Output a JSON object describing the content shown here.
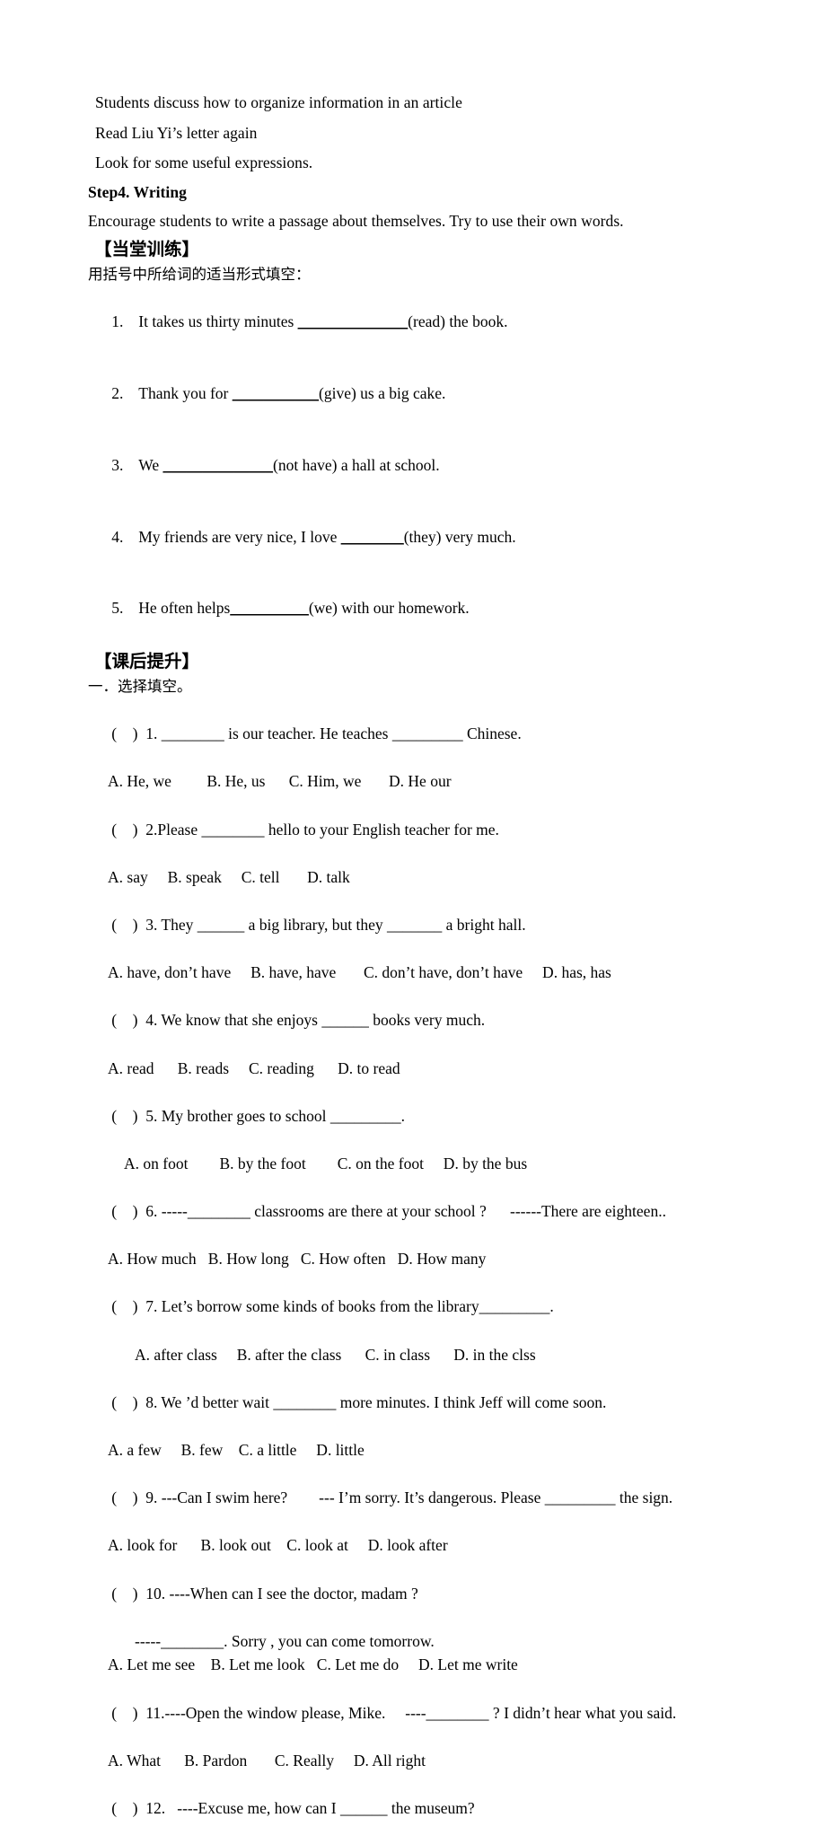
{
  "document": {
    "intro_lines": [
      "Students discuss how to organize information in an article",
      "Read Liu Yi’s letter again",
      "Look for some useful expressions."
    ],
    "step_heading": "Step4. Writing",
    "step_body": "Encourage students to write a passage about themselves. Try to use their own words.",
    "section_practice": {
      "heading": "【当堂训练】",
      "instruction": "用括号中所给词的适当形式填空：",
      "items": [
        {
          "num": "1.",
          "before": "It takes us thirty minutes ",
          "blank": "______________",
          "after": "(read) the book."
        },
        {
          "num": "2.",
          "before": "Thank you for ",
          "blank": "___________",
          "after": "(give) us a big cake."
        },
        {
          "num": "3.",
          "before": "We ",
          "blank": "______________",
          "after": "(not have) a hall at school."
        },
        {
          "num": "4.",
          "before": "My friends are very nice, I love ",
          "blank": "________",
          "after": "(they) very much."
        },
        {
          "num": "5.",
          "before": "He often helps",
          "blank": "__________",
          "after": "(we) with our homework."
        }
      ]
    },
    "section_homework": {
      "heading": "【课后提升】",
      "subheading": "一．选择填空。",
      "questions": [
        {
          "paren": "(    )",
          "stem": "1. ________ is our teacher. He teaches _________ Chinese.",
          "options": "A. He, we         B. He, us      C. Him, we       D. He our",
          "option_indent": "indent-opt"
        },
        {
          "paren": "(    )",
          "stem": "2.Please ________ hello to your English teacher for me.",
          "options": "A. say     B. speak     C. tell       D. talk",
          "option_indent": "indent-opt"
        },
        {
          "paren": "(    )",
          "stem": "3. They ______ a big library, but they _______ a bright hall.",
          "options": "A. have, don’t have     B. have, have       C. don’t have, don’t have     D. has, has",
          "option_indent": "indent-opt"
        },
        {
          "paren": "(    )",
          "stem": "4. We know that she enjoys ______ books very much.",
          "options": "A. read      B. reads     C. reading      D. to read",
          "option_indent": "indent-opt"
        },
        {
          "paren": "(    )",
          "stem": "5. My brother goes to school _________.",
          "options": "A. on foot        B. by the foot        C. on the foot     D. by the bus",
          "option_indent": "indent-opt2"
        },
        {
          "paren": "(    )",
          "stem": "6. -----________ classrooms are there at your school ?      ------There are eighteen..",
          "options": "A. How much   B. How long   C. How often   D. How many",
          "option_indent": "indent-opt"
        },
        {
          "paren": "(    )",
          "stem": "7. Let’s borrow some kinds of books from the library_________.",
          "options": "A. after class     B. after the class      C. in class      D. in the clss",
          "option_indent": "indent-q10b"
        },
        {
          "paren": "(    )",
          "stem": "8. We ’d better wait ________ more minutes. I think Jeff will come soon.",
          "options": "A. a few     B. few    C. a little     D. little",
          "option_indent": "indent-opt"
        },
        {
          "paren": "(    )",
          "stem": "9. ---Can I swim here?        --- I’m sorry. It’s dangerous. Please _________ the sign.",
          "options": "A. look for      B. look out    C. look at     D. look after",
          "option_indent": "indent-opt"
        },
        {
          "paren": "(    )",
          "stem": "10. ----When can I see the doctor, madam ?",
          "stem2": "-----________. Sorry , you can come tomorrow.",
          "options": "A. Let me see    B. Let me look   C. Let me do     D. Let me write",
          "option_indent": "indent-opt"
        },
        {
          "paren": "(    )",
          "stem": "11.----Open the window please, Mike.     ----________ ? I didn’t hear what you said.",
          "options": "A. What      B. Pardon       C. Really     D. All right",
          "option_indent": "indent-opt"
        },
        {
          "paren": "(    )",
          "stem": "12.   ----Excuse me, how can I ______ the museum?",
          "options": "",
          "option_indent": "indent-opt"
        }
      ]
    }
  }
}
